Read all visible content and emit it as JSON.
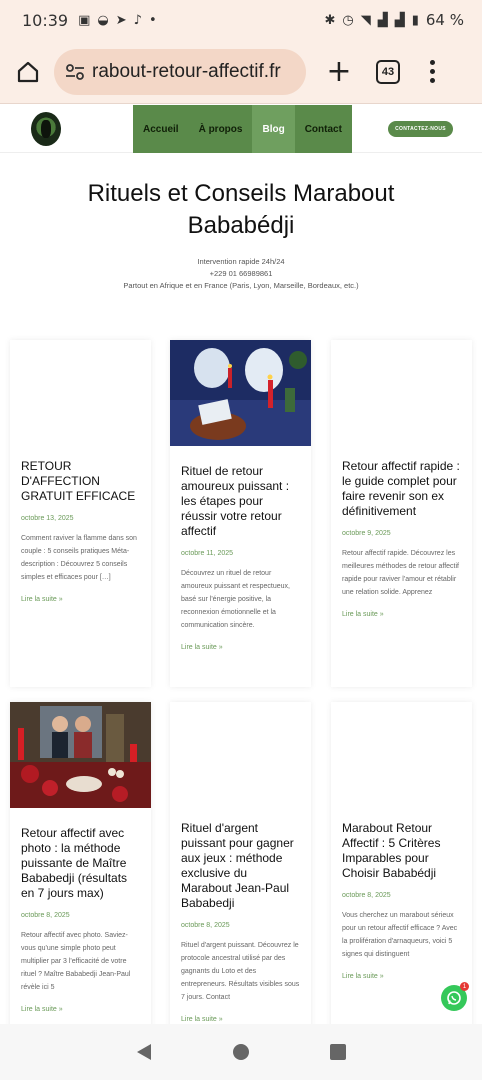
{
  "status_bar": {
    "time": "10:39",
    "battery": "64 %"
  },
  "browser": {
    "url": "rabout-retour-affectif.fr",
    "tab_count": "43"
  },
  "site": {
    "nav": [
      {
        "label": "Accueil",
        "active": false
      },
      {
        "label": "À propos",
        "active": false
      },
      {
        "label": "Blog",
        "active": true
      },
      {
        "label": "Contact",
        "active": false
      }
    ],
    "cta": "CONTACTEZ-NOUS"
  },
  "hero": {
    "title_line1": "Rituels et Conseils Marabout",
    "title_line2": "Bababédji",
    "line1": "Intervention rapide 24h/24",
    "line2": "+229 01 66989861",
    "line3": "Partout en Afrique et en France (Paris, Lyon, Marseille, Bordeaux, etc.)"
  },
  "posts": [
    {
      "title": "RETOUR D'AFFECTION GRATUIT EFFICACE",
      "date": "octobre 13, 2025",
      "excerpt": "Comment raviver la flamme dans son couple : 5 conseils pratiques Méta-description : Découvrez 5 conseils simples et efficaces pour […]",
      "more": "Lire la suite »",
      "image": "none"
    },
    {
      "title": "Rituel de retour amoureux puissant : les étapes pour réussir votre retour affectif",
      "date": "octobre 11, 2025",
      "excerpt": "Découvrez un rituel de retour amoureux puissant et respectueux, basé sur l'énergie positive, la reconnexion émotionnelle et la communication sincère.",
      "more": "Lire la suite »",
      "image": "ritual-altar-blue"
    },
    {
      "title": "Retour affectif rapide : le guide complet pour faire revenir son ex définitivement",
      "date": "octobre 9, 2025",
      "excerpt": "Retour affectif rapide. Découvrez les meilleures méthodes de retour affectif rapide pour raviver l'amour et rétablir une relation solide. Apprenez",
      "more": "Lire la suite »",
      "image": "none"
    },
    {
      "title": "Retour affectif avec photo : la méthode puissante de Maître Bababedji (résultats en 7 jours max)",
      "date": "octobre 8, 2025",
      "excerpt": "Retour affectif avec photo. Saviez-vous qu'une simple photo peut multiplier par 3 l'efficacité de votre rituel ? Maître Bababedji Jean-Paul révèle ici 5",
      "more": "Lire la suite »",
      "image": "couple-photo-candles"
    },
    {
      "title": "Rituel d'argent puissant pour gagner aux jeux : méthode exclusive du Marabout Jean-Paul Bababedji",
      "date": "octobre 8, 2025",
      "excerpt": "Rituel d'argent puissant. Découvrez le protocole ancestral utilisé par des gagnants du Loto et des entrepreneurs. Résultats visibles sous 7 jours. Contact",
      "more": "Lire la suite »",
      "image": "none"
    },
    {
      "title": "Marabout Retour Affectif : 5 Critères Imparables pour Choisir Bababédji",
      "date": "octobre 8, 2025",
      "excerpt": "Vous cherchez un marabout sérieux pour un retour affectif efficace ? Avec la prolifération d'arnaqueurs, voici 5 signes qui distinguent",
      "more": "Lire la suite »",
      "image": "none"
    }
  ],
  "whatsapp_badge": "1",
  "colors": {
    "brand_green": "#5a8a4a",
    "accent_green": "#6a9a58",
    "browser_bg": "#fbeee6"
  }
}
